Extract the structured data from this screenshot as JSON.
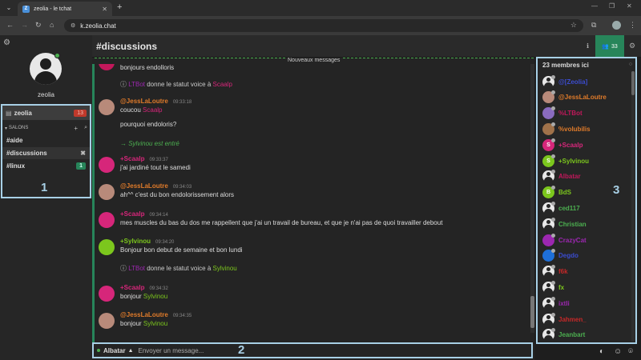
{
  "browser": {
    "tab_title": "zeolia - le tchat",
    "favicon_letter": "Z",
    "url": "k.zeolia.chat"
  },
  "sidebar": {
    "username": "zeolia",
    "server": {
      "name": "zeolia",
      "unread": "13"
    },
    "salons_label": "SALONS",
    "channels": [
      {
        "name": "#aide",
        "badge": ""
      },
      {
        "name": "#discussions",
        "badge": ""
      },
      {
        "name": "#linux",
        "badge": "1"
      }
    ]
  },
  "annotations": {
    "left": "1",
    "input": "2",
    "members": "3"
  },
  "header": {
    "channel": "#discussions",
    "members_count": "33"
  },
  "new_messages_label": "Nouveaux messages",
  "messages": {
    "m0": {
      "text": "bonjours endolloris"
    },
    "sys1": {
      "bot": "LTBot",
      "mid": " donne le statut voice à ",
      "target": "Scaalp"
    },
    "m1": {
      "nick": "@JessLaLoutre",
      "time": "09:33:18",
      "line1_a": "coucou ",
      "line1_b": "Scaalp",
      "line2": "pourquoi endoloris?"
    },
    "join1": {
      "text": "→ Sylvinou est entré"
    },
    "m2": {
      "nick": "+Scaalp",
      "time": "09:33:37",
      "line1": "j'ai jardiné tout le samedi"
    },
    "m3": {
      "nick": "@JessLaLoutre",
      "time": "09:34:03",
      "line1": "ah^^ c'est du bon endolorissement alors"
    },
    "m4": {
      "nick": "+Scaalp",
      "time": "09:34:14",
      "line1": "mes muscles du bas du dos me rappellent que j'ai un travail de bureau, et que je n'ai pas de quoi travailler debout"
    },
    "m5": {
      "nick": "+Sylvinou",
      "time": "09:34:20",
      "line1": "Bonjour bon debut de semaine et bon lundi"
    },
    "sys2": {
      "bot": "LTBot",
      "mid": " donne le statut voice à ",
      "target": "Sylvinou"
    },
    "m6": {
      "nick": "+Scaalp",
      "time": "09:34:32",
      "line1_a": "bonjour ",
      "line1_b": "Sylvinou"
    },
    "m7": {
      "nick": "@JessLaLoutre",
      "time": "09:34:35",
      "line1_a": "bonjour ",
      "line1_b": "Sylvinou"
    }
  },
  "input": {
    "nick": "Albatar",
    "placeholder": "Envoyer un message..."
  },
  "members": {
    "header": "23 membres ici",
    "list": [
      {
        "name": "@[Zeolia]",
        "color": "#3b4ccf"
      },
      {
        "name": "@JessLaLoutre",
        "color": "#e07b2a"
      },
      {
        "name": "%LTBot",
        "color": "#c2185b"
      },
      {
        "name": "%volubilis",
        "color": "#e07b2a"
      },
      {
        "name": "+Scaalp",
        "color": "#d6267a"
      },
      {
        "name": "+Sylvinou",
        "color": "#7cc71d"
      },
      {
        "name": "Albatar",
        "color": "#c2185b"
      },
      {
        "name": "BdS",
        "color": "#7cc71d"
      },
      {
        "name": "ced117",
        "color": "#4caf50"
      },
      {
        "name": "Christian",
        "color": "#4caf50"
      },
      {
        "name": "CrazyCat",
        "color": "#9c27b0"
      },
      {
        "name": "Degdo",
        "color": "#3b4ccf"
      },
      {
        "name": "f6k",
        "color": "#c62828"
      },
      {
        "name": "fx",
        "color": "#7cc71d"
      },
      {
        "name": "ixtli",
        "color": "#9c27b0"
      },
      {
        "name": "Jahmen_",
        "color": "#c62828"
      },
      {
        "name": "Jeanbart",
        "color": "#4caf50"
      }
    ]
  }
}
